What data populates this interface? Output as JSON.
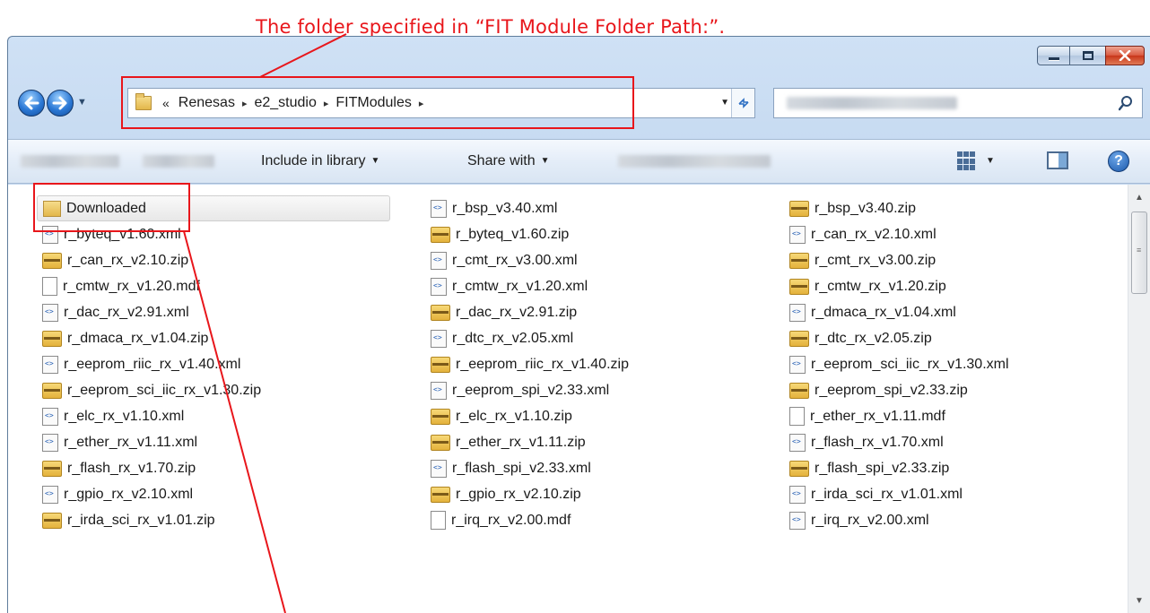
{
  "annotation": {
    "text": "The folder specified in “FIT Module Folder Path:”.",
    "color": "#e8161b"
  },
  "window_controls": {
    "minimize_icon": "minimize-icon",
    "maximize_icon": "maximize-icon",
    "close_icon": "close-icon"
  },
  "address_bar": {
    "overflow": "«",
    "crumbs": [
      "Renesas",
      "e2_studio",
      "FITModules"
    ],
    "separator": "▸"
  },
  "toolbar": {
    "include_in_library": "Include in library",
    "share_with": "Share with"
  },
  "files": [
    {
      "name": "Downloaded",
      "type": "folder"
    },
    {
      "name": "r_bsp_v3.40.xml",
      "type": "xml"
    },
    {
      "name": "r_bsp_v3.40.zip",
      "type": "zip"
    },
    {
      "name": "r_byteq_v1.60.xml",
      "type": "xml"
    },
    {
      "name": "r_byteq_v1.60.zip",
      "type": "zip"
    },
    {
      "name": "r_can_rx_v2.10.xml",
      "type": "xml"
    },
    {
      "name": "r_can_rx_v2.10.zip",
      "type": "zip"
    },
    {
      "name": "r_cmt_rx_v3.00.xml",
      "type": "xml"
    },
    {
      "name": "r_cmt_rx_v3.00.zip",
      "type": "zip"
    },
    {
      "name": "r_cmtw_rx_v1.20.mdf",
      "type": "mdf"
    },
    {
      "name": "r_cmtw_rx_v1.20.xml",
      "type": "xml"
    },
    {
      "name": "r_cmtw_rx_v1.20.zip",
      "type": "zip"
    },
    {
      "name": "r_dac_rx_v2.91.xml",
      "type": "xml"
    },
    {
      "name": "r_dac_rx_v2.91.zip",
      "type": "zip"
    },
    {
      "name": "r_dmaca_rx_v1.04.xml",
      "type": "xml"
    },
    {
      "name": "r_dmaca_rx_v1.04.zip",
      "type": "zip"
    },
    {
      "name": "r_dtc_rx_v2.05.xml",
      "type": "xml"
    },
    {
      "name": "r_dtc_rx_v2.05.zip",
      "type": "zip"
    },
    {
      "name": "r_eeprom_riic_rx_v1.40.xml",
      "type": "xml"
    },
    {
      "name": "r_eeprom_riic_rx_v1.40.zip",
      "type": "zip"
    },
    {
      "name": "r_eeprom_sci_iic_rx_v1.30.xml",
      "type": "xml"
    },
    {
      "name": "r_eeprom_sci_iic_rx_v1.30.zip",
      "type": "zip"
    },
    {
      "name": "r_eeprom_spi_v2.33.xml",
      "type": "xml"
    },
    {
      "name": "r_eeprom_spi_v2.33.zip",
      "type": "zip"
    },
    {
      "name": "r_elc_rx_v1.10.xml",
      "type": "xml"
    },
    {
      "name": "r_elc_rx_v1.10.zip",
      "type": "zip"
    },
    {
      "name": "r_ether_rx_v1.11.mdf",
      "type": "mdf"
    },
    {
      "name": "r_ether_rx_v1.11.xml",
      "type": "xml"
    },
    {
      "name": "r_ether_rx_v1.11.zip",
      "type": "zip"
    },
    {
      "name": "r_flash_rx_v1.70.xml",
      "type": "xml"
    },
    {
      "name": "r_flash_rx_v1.70.zip",
      "type": "zip"
    },
    {
      "name": "r_flash_spi_v2.33.xml",
      "type": "xml"
    },
    {
      "name": "r_flash_spi_v2.33.zip",
      "type": "zip"
    },
    {
      "name": "r_gpio_rx_v2.10.xml",
      "type": "xml"
    },
    {
      "name": "r_gpio_rx_v2.10.zip",
      "type": "zip"
    },
    {
      "name": "r_irda_sci_rx_v1.01.xml",
      "type": "xml"
    },
    {
      "name": "r_irda_sci_rx_v1.01.zip",
      "type": "zip"
    },
    {
      "name": "r_irq_rx_v2.00.mdf",
      "type": "mdf"
    },
    {
      "name": "r_irq_rx_v2.00.xml",
      "type": "xml"
    }
  ]
}
